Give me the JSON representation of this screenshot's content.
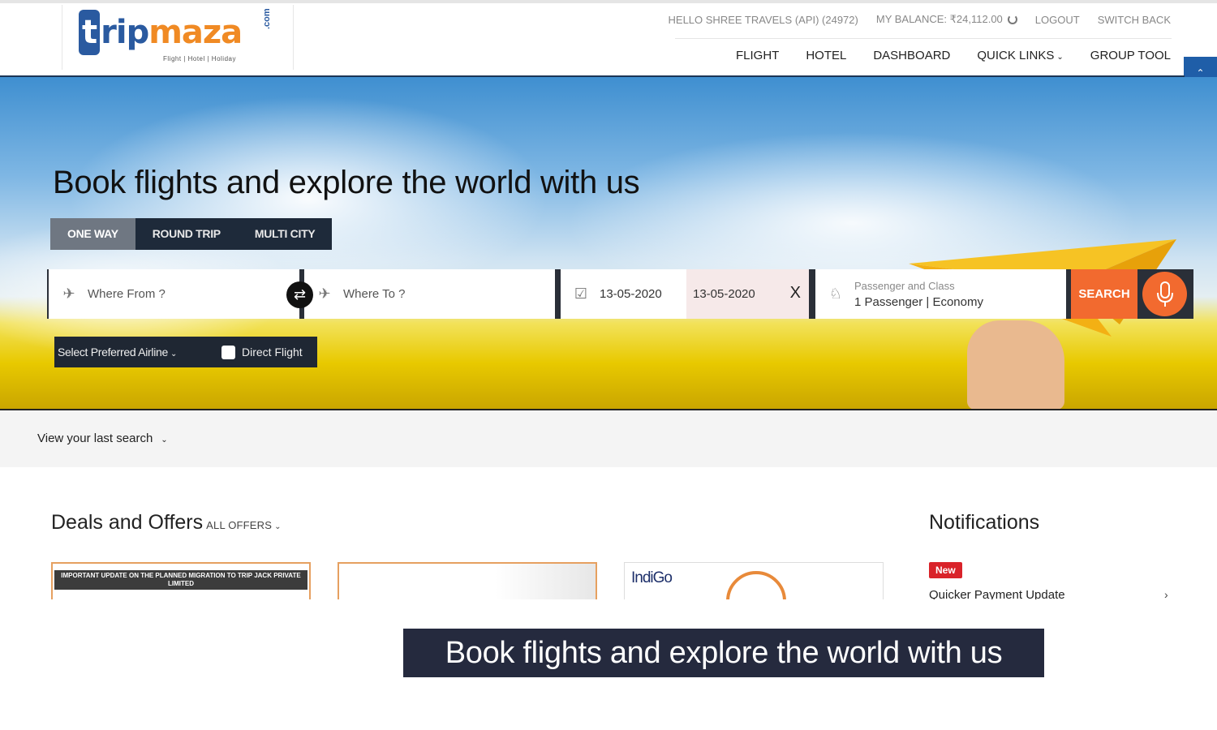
{
  "logo": {
    "t": "t",
    "rip": "rip",
    "maza": "maza",
    "com": ".com",
    "tagline": "Flight  |  Hotel  |  Holiday"
  },
  "user_bar": {
    "greeting": "HELLO SHREE TRAVELS (API) (24972)",
    "balance": "MY BALANCE: ₹24,112.00",
    "logout": "LOGOUT",
    "switch_back": "SWITCH BACK"
  },
  "nav": {
    "flight": "FLIGHT",
    "hotel": "HOTEL",
    "dashboard": "DASHBOARD",
    "quick_links": "QUICK LINKS",
    "group_tool": "GROUP TOOL"
  },
  "scroll_top_icon": "chevron-up-icon",
  "hero": {
    "title": "Book flights and explore the world with us"
  },
  "trip_tabs": [
    {
      "label": "ONE WAY",
      "active": true
    },
    {
      "label": "ROUND TRIP",
      "active": false
    },
    {
      "label": "MULTI CITY",
      "active": false
    }
  ],
  "search": {
    "from_placeholder": "Where From ?",
    "to_placeholder": "Where To ?",
    "departure_date": "13-05-2020",
    "return_date": "13-05-2020",
    "pax_label": "Passenger and Class",
    "pax_value": "1 Passenger | Economy",
    "search_label": "SEARCH",
    "clear_symbol": "X"
  },
  "options": {
    "airline_select": "Select Preferred Airline",
    "direct_flight": "Direct Flight"
  },
  "last_search": {
    "label": "View your last search"
  },
  "deals": {
    "title": "Deals and Offers",
    "all_offers": "ALL OFFERS",
    "card1_text": "IMPORTANT UPDATE ON THE PLANNED MIGRATION TO TRIP JACK PRIVATE LIMITED",
    "card3_logo": "IndiGo"
  },
  "notifications": {
    "title": "Notifications",
    "badge": "New",
    "item": "Quicker Payment Update"
  },
  "caption": {
    "text": "Book flights and explore the world with us"
  },
  "colors": {
    "brand_blue": "#2a5aa0",
    "brand_orange": "#f08a24",
    "search_orange": "#f26a2f",
    "tab_dark": "#1e2a3a",
    "badge_red": "#d9232a"
  }
}
